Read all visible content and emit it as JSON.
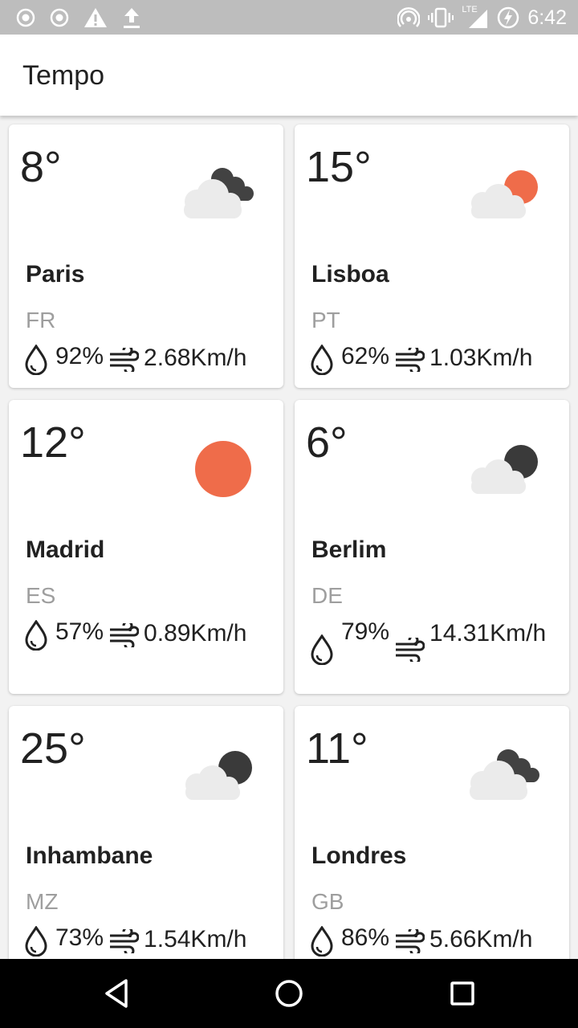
{
  "status_bar": {
    "left_icons": [
      "notification-dot-icon",
      "notification-dot-icon",
      "warning-icon",
      "upload-icon"
    ],
    "right_icons": [
      "hotspot-icon",
      "vibrate-icon",
      "lte-signal-icon",
      "battery-charging-icon"
    ],
    "lte_label": "LTE",
    "time": "6:42"
  },
  "app_bar": {
    "title": "Tempo"
  },
  "colors": {
    "sun": "#ef6c4a",
    "cloud": "#ebebeb",
    "dark_cloud": "#424242",
    "moon": "#3a3a3a"
  },
  "cities": [
    {
      "temp": "8°",
      "city": "Paris",
      "country": "FR",
      "humidity": "92%",
      "wind": "2.68Km/h",
      "icon": "cloudy-night-icon"
    },
    {
      "temp": "15°",
      "city": "Lisboa",
      "country": "PT",
      "humidity": "62%",
      "wind": "1.03Km/h",
      "icon": "partly-cloudy-day-icon"
    },
    {
      "temp": "12°",
      "city": "Madrid",
      "country": "ES",
      "humidity": "57%",
      "wind": "0.89Km/h",
      "icon": "sun-icon"
    },
    {
      "temp": "6°",
      "city": "Berlim",
      "country": "DE",
      "humidity": "79%",
      "wind": "14.31Km/h",
      "icon": "partly-cloudy-night-icon"
    },
    {
      "temp": "25°",
      "city": "Inhambane",
      "country": "MZ",
      "humidity": "73%",
      "wind": "1.54Km/h",
      "icon": "partly-cloudy-night-icon"
    },
    {
      "temp": "11°",
      "city": "Londres",
      "country": "GB",
      "humidity": "86%",
      "wind": "5.66Km/h",
      "icon": "cloudy-night-icon"
    }
  ],
  "nav_bar": {
    "buttons": [
      "back-icon",
      "home-icon",
      "recents-icon"
    ]
  }
}
